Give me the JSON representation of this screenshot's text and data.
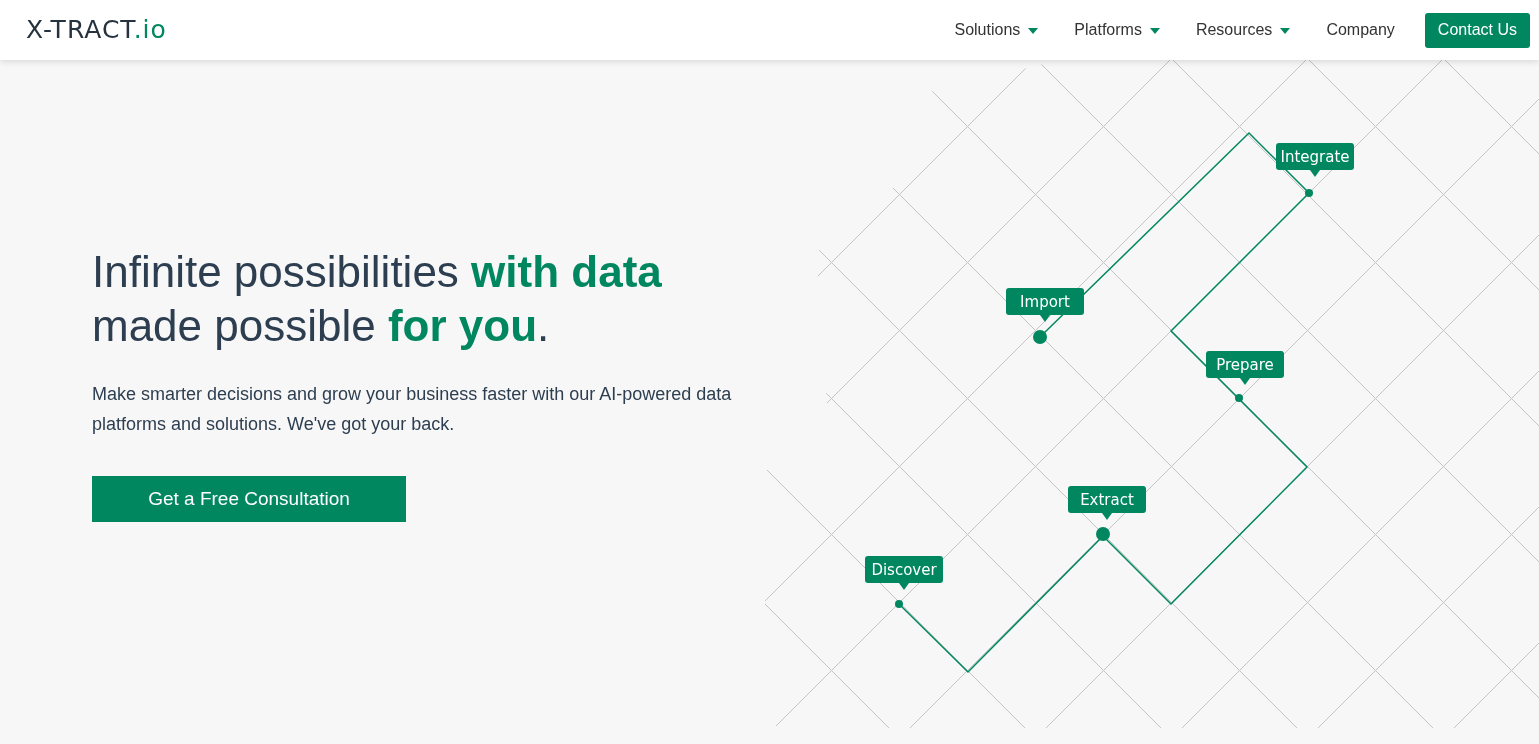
{
  "logo": {
    "main": "X-TRACT",
    "suffix": ".io"
  },
  "nav": [
    {
      "label": "Solutions",
      "has_dropdown": true
    },
    {
      "label": "Platforms",
      "has_dropdown": true
    },
    {
      "label": "Resources",
      "has_dropdown": true
    },
    {
      "label": "Company",
      "has_dropdown": false
    }
  ],
  "contact_button": "Contact Us",
  "hero": {
    "headline_lines": [
      "Infinite possibilities **with data**",
      "made possible **for you**."
    ],
    "text": "Make smarter decisions and grow your business faster with our AI-powered data platforms and solutions. We've got your back.",
    "cta": "Get a Free Consultation"
  },
  "steps": [
    {
      "label": "Integrate"
    },
    {
      "label": "Import"
    },
    {
      "label": "Prepare"
    },
    {
      "label": "Extract"
    },
    {
      "label": "Discover"
    }
  ]
}
